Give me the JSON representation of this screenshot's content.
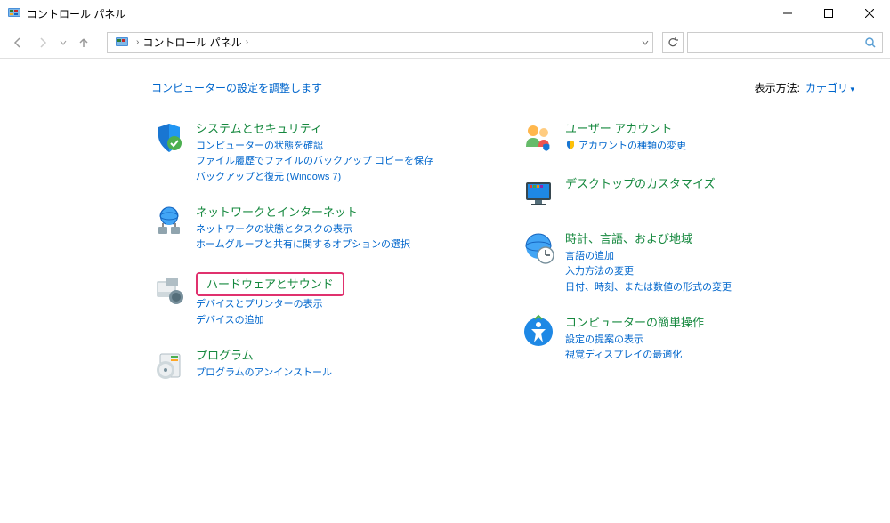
{
  "window": {
    "title": "コントロール パネル"
  },
  "breadcrumb": {
    "text": "コントロール パネル"
  },
  "search": {
    "placeholder": ""
  },
  "header": {
    "title": "コンピューターの設定を調整します",
    "view_label": "表示方法:",
    "view_value": "カテゴリ"
  },
  "categories": {
    "left": [
      {
        "icon": "shield-icon",
        "title": "システムとセキュリティ",
        "links": [
          "コンピューターの状態を確認",
          "ファイル履歴でファイルのバックアップ コピーを保存",
          "バックアップと復元 (Windows 7)"
        ]
      },
      {
        "icon": "network-icon",
        "title": "ネットワークとインターネット",
        "links": [
          "ネットワークの状態とタスクの表示",
          "ホームグループと共有に関するオプションの選択"
        ]
      },
      {
        "icon": "hardware-icon",
        "title": "ハードウェアとサウンド",
        "highlighted": true,
        "links": [
          "デバイスとプリンターの表示",
          "デバイスの追加"
        ]
      },
      {
        "icon": "programs-icon",
        "title": "プログラム",
        "links": [
          "プログラムのアンインストール"
        ]
      }
    ],
    "right": [
      {
        "icon": "users-icon",
        "title": "ユーザー アカウント",
        "links": [
          "アカウントの種類の変更"
        ]
      },
      {
        "icon": "desktop-icon",
        "title": "デスクトップのカスタマイズ",
        "links": []
      },
      {
        "icon": "clock-icon",
        "title": "時計、言語、および地域",
        "links": [
          "言語の追加",
          "入力方法の変更",
          "日付、時刻、または数値の形式の変更"
        ]
      },
      {
        "icon": "access-icon",
        "title": "コンピューターの簡単操作",
        "links": [
          "設定の提案の表示",
          "視覚ディスプレイの最適化"
        ]
      }
    ]
  }
}
